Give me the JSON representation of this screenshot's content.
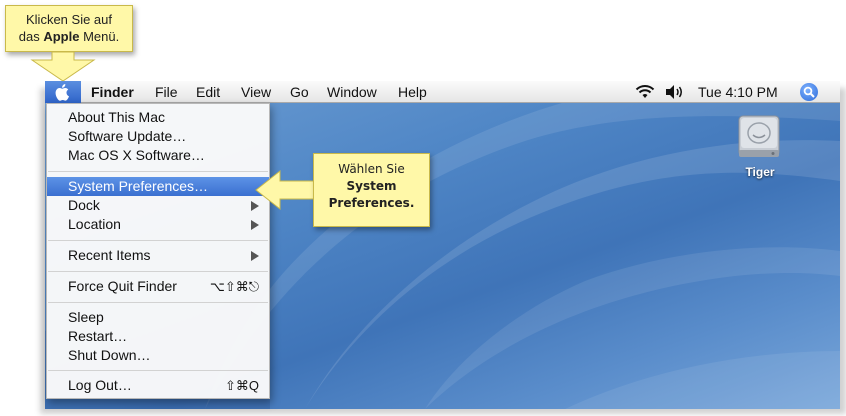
{
  "callouts": {
    "top": {
      "line1": "Klicken Sie auf",
      "line2_prefix": "das ",
      "line2_bold": "Apple",
      "line2_suffix": " Menü."
    },
    "middle": {
      "line1": "Wählen Sie",
      "line2": "System",
      "line3": "Preferences."
    }
  },
  "menubar": {
    "app": "Finder",
    "items": [
      "File",
      "Edit",
      "View",
      "Go",
      "Window",
      "Help"
    ],
    "clock": "Tue 4:10 PM",
    "icons": [
      "wifi-icon",
      "volume-icon",
      "spotlight-icon"
    ]
  },
  "apple_menu": {
    "items": [
      {
        "label": "About This Mac",
        "shortcut": ""
      },
      {
        "label": "Software Update…",
        "shortcut": ""
      },
      {
        "label": "Mac OS X Software…",
        "shortcut": ""
      },
      {
        "label": "System Preferences…",
        "shortcut": "",
        "selected": true
      },
      {
        "label": "Dock",
        "submenu": true
      },
      {
        "label": "Location",
        "submenu": true
      },
      {
        "label": "Recent Items",
        "submenu": true
      },
      {
        "label": "Force Quit Finder",
        "shortcut": "⌥⇧⌘⎋"
      },
      {
        "label": "Sleep",
        "shortcut": ""
      },
      {
        "label": "Restart…",
        "shortcut": ""
      },
      {
        "label": "Shut Down…",
        "shortcut": ""
      },
      {
        "label": "Log Out…",
        "shortcut": "⇧⌘Q"
      }
    ]
  },
  "desktop": {
    "drive_label": "Tiger"
  },
  "colors": {
    "callout_bg": "#fff8a8",
    "selection": "#3a6fd0",
    "desktop": "#4f86c6"
  }
}
